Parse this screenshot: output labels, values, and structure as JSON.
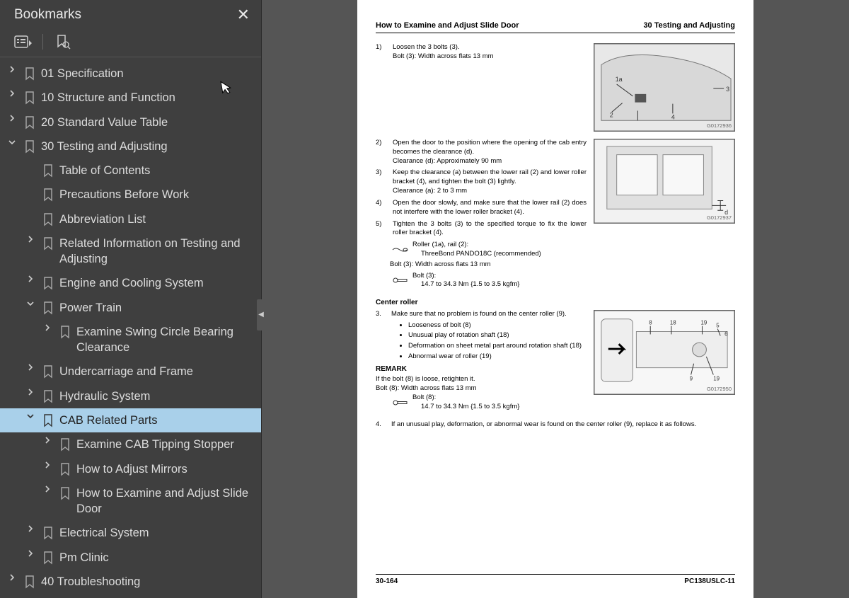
{
  "sidebar": {
    "title": "Bookmarks",
    "items": [
      {
        "label": "01 Specification",
        "indent": 0,
        "chev": "right"
      },
      {
        "label": "10 Structure and Function",
        "indent": 0,
        "chev": "right"
      },
      {
        "label": "20 Standard Value Table",
        "indent": 0,
        "chev": "right"
      },
      {
        "label": "30 Testing and Adjusting",
        "indent": 0,
        "chev": "down"
      },
      {
        "label": "Table of Contents",
        "indent": 1,
        "chev": ""
      },
      {
        "label": "Precautions Before Work",
        "indent": 1,
        "chev": ""
      },
      {
        "label": "Abbreviation List",
        "indent": 1,
        "chev": ""
      },
      {
        "label": "Related Information on Testing and Adjusting",
        "indent": 1,
        "chev": "right"
      },
      {
        "label": "Engine and Cooling System",
        "indent": 1,
        "chev": "right"
      },
      {
        "label": "Power Train",
        "indent": 1,
        "chev": "down"
      },
      {
        "label": "Examine Swing Circle Bearing Clearance",
        "indent": 2,
        "chev": "right"
      },
      {
        "label": "Undercarriage and Frame",
        "indent": 1,
        "chev": "right"
      },
      {
        "label": "Hydraulic System",
        "indent": 1,
        "chev": "right"
      },
      {
        "label": "CAB Related Parts",
        "indent": 1,
        "chev": "down",
        "selected": true
      },
      {
        "label": "Examine CAB Tipping Stopper",
        "indent": 2,
        "chev": "right"
      },
      {
        "label": "How to Adjust Mirrors",
        "indent": 2,
        "chev": "right"
      },
      {
        "label": "How to Examine and Adjust Slide Door",
        "indent": 2,
        "chev": "right"
      },
      {
        "label": "Electrical System",
        "indent": 1,
        "chev": "right"
      },
      {
        "label": "Pm Clinic",
        "indent": 1,
        "chev": "right"
      },
      {
        "label": "40 Troubleshooting",
        "indent": 0,
        "chev": "right"
      }
    ]
  },
  "page": {
    "head_left": "How to Examine and Adjust Slide Door",
    "head_right": "30 Testing and Adjusting",
    "foot_left": "30-164",
    "foot_right": "PC138USLC-11",
    "img_ids": {
      "a": "G0172936",
      "b": "G0172937",
      "c": "G0172950"
    },
    "step1_num": "1)",
    "step1_a": "Loosen the 3 bolts (3).",
    "step1_b": "Bolt (3): Width across flats 13 mm",
    "step2_num": "2)",
    "step2_a": "Open the door to the position where the opening of the cab entry becomes the clearance (d).",
    "step2_b": "Clearance (d): Approximately 90 mm",
    "step3_num": "3)",
    "step3_a": "Keep the clearance (a) between the lower rail (2) and lower roller bracket (4), and tighten the bolt (3) lightly.",
    "step3_b": "Clearance (a): 2 to 3 mm",
    "step4_num": "4)",
    "step4_a": "Open the door slowly, and make sure that the lower rail (2) does not interfere with the lower roller bracket (4).",
    "step5_num": "5)",
    "step5_a": "Tighten the 3 bolts (3) to the specified torque to fix the lower roller bracket (4).",
    "roller_a": "Roller (1a), rail (2):",
    "roller_b": "ThreeBond PANDO18C (recommended)",
    "bolt3_flat": "Bolt (3): Width across flats 13 mm",
    "bolt3_title": "Bolt (3):",
    "bolt3_torque": "14.7 to 34.3 Nm {1.5 to 3.5 kgfm}",
    "center_heading": "Center roller",
    "cr3_num": "3.",
    "cr3_text": "Make sure that no problem is found on the center roller (9).",
    "bullets": {
      "a": "Looseness of bolt (8)",
      "b": "Unusual play of rotation shaft (18)",
      "c": "Deformation on sheet metal part around rotation shaft (18)",
      "d": "Abnormal wear of roller (19)"
    },
    "remark_label": "REMARK",
    "remark_a": "If the bolt (8) is loose, retighten it.",
    "remark_b": "Bolt (8): Width across flats 13 mm",
    "bolt8_title": "Bolt (8):",
    "bolt8_torque": "14.7 to 34.3 Nm {1.5 to 3.5 kgfm}",
    "cr4_num": "4.",
    "cr4_text": "If an unusual play, deformation, or abnormal wear is found on the center roller (9), replace it as follows."
  }
}
